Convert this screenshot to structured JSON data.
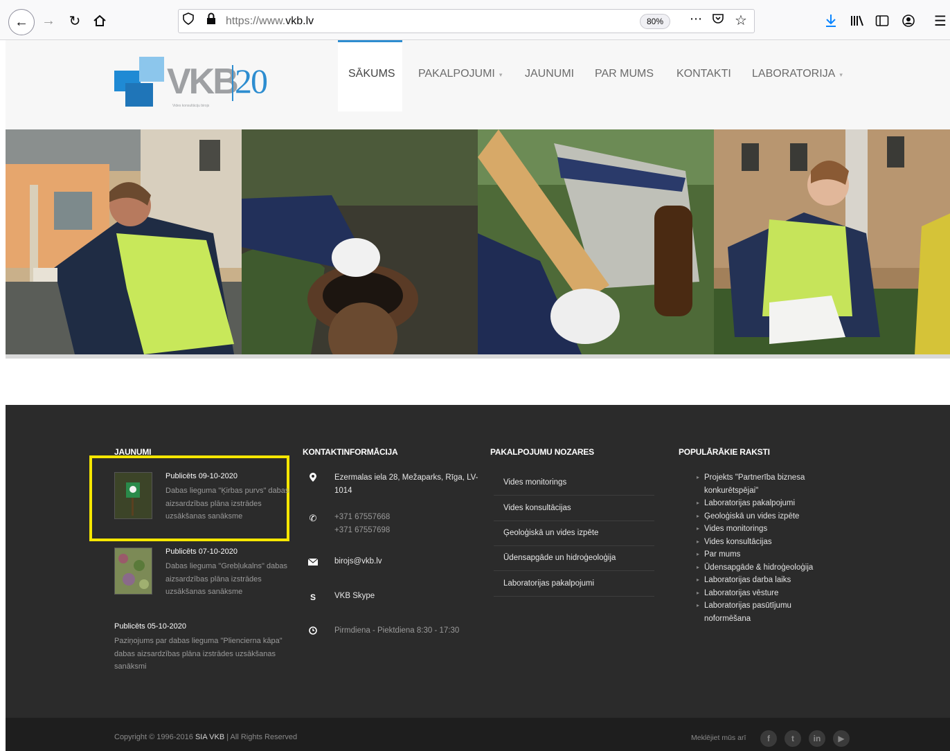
{
  "browser": {
    "url_prefix": "https://www.",
    "url_domain": "vkb.lv",
    "zoom": "80%"
  },
  "logo": {
    "name": "VKB",
    "number": "20",
    "tagline": "Vides konsultāciju birojs"
  },
  "nav": {
    "items": [
      "SĀKUMS",
      "PAKALPOJUMI",
      "JAUNUMI",
      "PAR MUMS",
      "KONTAKTI",
      "LABORATORIJA"
    ]
  },
  "footer": {
    "news": {
      "title": "JAUNUMI",
      "items": [
        {
          "date": "Publicēts 09-10-2020",
          "text": "Dabas lieguma \"Ķirbas purvs\" dabas aizsardzības plāna izstrādes uzsākšanas sanāksme"
        },
        {
          "date": "Publicēts 07-10-2020",
          "text": "Dabas lieguma \"Grebļukalns\" dabas aizsardzības plāna izstrādes uzsākšanas sanāksme"
        },
        {
          "date": "Publicēts 05-10-2020",
          "text": "Paziņojums par dabas lieguma \"Pliencierna kāpa\" dabas aizsardzības plāna izstrādes uzsākšanas sanāksmi"
        }
      ]
    },
    "contact": {
      "title": "KONTAKTINFORMĀCIJA",
      "address": "Ezermalas iela 28, Mežaparks, Rīga, LV-1014",
      "phone1": "+371 67557668",
      "phone2": "+371 67557698",
      "email": "birojs@vkb.lv",
      "skype": "VKB Skype",
      "hours": "Pirmdiena - Piektdiena 8:30 - 17:30"
    },
    "services": {
      "title": "PAKALPOJUMU NOZARES",
      "items": [
        "Vides monitorings",
        "Vides konsultācijas",
        "Ģeoloģiskā un vides izpēte",
        "Ūdensapgāde un hidroģeoloģija",
        "Laboratorijas pakalpojumi"
      ]
    },
    "popular": {
      "title": "POPULĀRĀKIE RAKSTI",
      "items": [
        "Projekts \"Partnerība biznesa konkurētspējai\"",
        "Laboratorijas pakalpojumi",
        "Ģeoloģiskā un vides izpēte",
        "Vides monitorings",
        "Vides konsultācijas",
        "Par mums",
        "Ūdensapgāde & hidroģeoloģija",
        "Laboratorijas darba laiks",
        "Laboratorijas vēsture",
        "Laboratorijas pasūtījumu noformēšana"
      ]
    },
    "copyright_prefix": "Copyright © 1996-2016",
    "copyright_company": "SIA VKB",
    "copyright_suffix": "|  All Rights Reserved",
    "social_label": "Meklējiet mūs arī"
  }
}
